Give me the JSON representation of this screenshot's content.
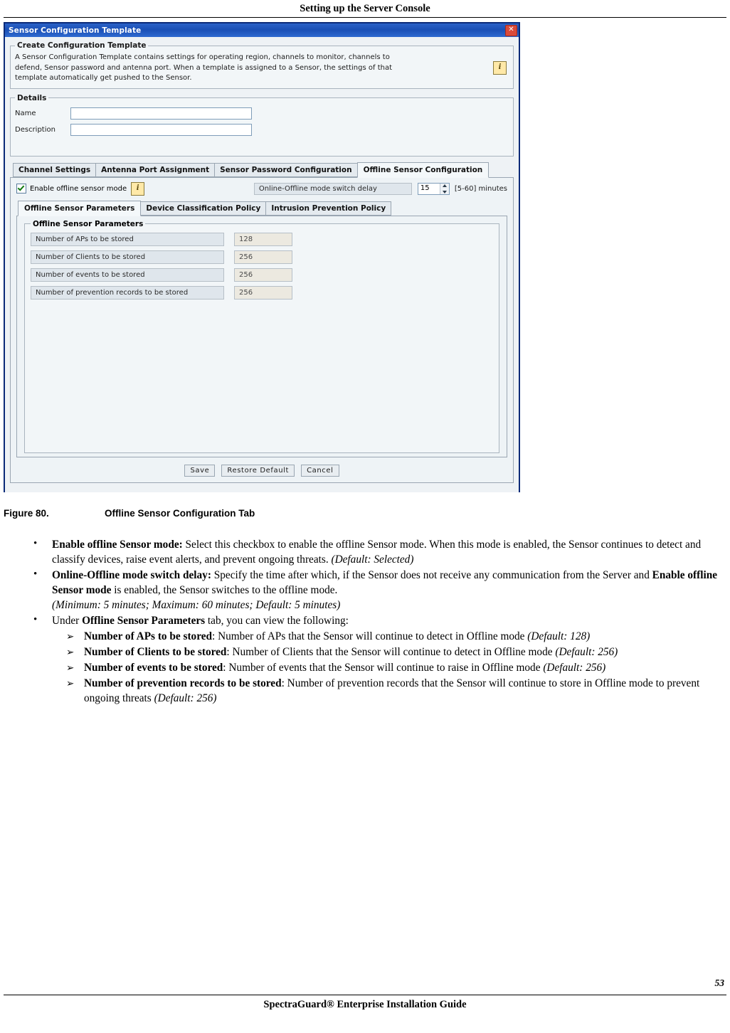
{
  "page": {
    "running_head": "Setting up the Server Console",
    "page_number": "53",
    "footer_title": "SpectraGuard®  Enterprise Installation Guide"
  },
  "dialog": {
    "title": "Sensor Configuration Template",
    "close_icon": "✕",
    "create_group": {
      "legend": "Create Configuration Template",
      "description": "A Sensor Configuration Template contains settings for operating region, channels to monitor, channels to defend, Sensor password and antenna port. When a template is assigned to a Sensor, the settings of that template automatically get pushed to the Sensor.",
      "info_icon": "i"
    },
    "details_group": {
      "legend": "Details",
      "name_label": "Name",
      "name_value": "",
      "description_label": "Description",
      "description_value": ""
    },
    "tabs": [
      {
        "label": "Channel Settings",
        "active": false
      },
      {
        "label": "Antenna Port Assignment",
        "active": false
      },
      {
        "label": "Sensor Password Configuration",
        "active": false
      },
      {
        "label": "Offline Sensor Configuration",
        "active": true
      }
    ],
    "offline": {
      "checkbox_label": "Enable offline sensor mode",
      "checkbox_checked": true,
      "info_icon": "i",
      "delay_label": "Online-Offline mode switch delay",
      "delay_value": "15",
      "range_note": "[5-60] minutes"
    },
    "inner_tabs": [
      {
        "label": "Offline Sensor Parameters",
        "active": true
      },
      {
        "label": "Device Classification Policy",
        "active": false
      },
      {
        "label": "Intrusion Prevention Policy",
        "active": false
      }
    ],
    "parameters_group": {
      "legend": "Offline Sensor Parameters",
      "rows": [
        {
          "label": "Number of APs to be stored",
          "value": "128"
        },
        {
          "label": "Number of Clients to be stored",
          "value": "256"
        },
        {
          "label": "Number of events to be stored",
          "value": "256"
        },
        {
          "label": "Number of prevention records to be stored",
          "value": "256"
        }
      ]
    },
    "buttons": [
      {
        "label": "Save"
      },
      {
        "label": "Restore Default"
      },
      {
        "label": "Cancel"
      }
    ]
  },
  "figure": {
    "number": "Figure  80.",
    "caption": "Offline Sensor Configuration Tab"
  },
  "body": {
    "bullets": [
      {
        "bullet": "•",
        "term": "Enable offline Sensor mode:",
        "text": " Select this checkbox to enable the offline Sensor mode. When this mode is enabled, the Sensor continues to detect and classify devices, raise event alerts, and prevent ongoing threats. ",
        "italic_tail": "(Default: Selected)"
      },
      {
        "bullet": "•",
        "term": "Online-Offline mode switch delay:",
        "text": " Specify the time after which, if the Sensor does not receive any communication from the Server and ",
        "term2": "Enable offline Sensor mode",
        "text2": " is enabled, the Sensor switches to the offline mode.",
        "italic_tail": "(Minimum: 5 minutes; Maximum: 60 minutes; Default: 5 minutes)"
      }
    ],
    "under_line": {
      "bullet": "•",
      "prefix": "Under ",
      "term": "Offline Sensor Parameters",
      "suffix": " tab, you can view the following:"
    },
    "sub_items": [
      {
        "arrow": "➢",
        "term": "Number of APs to be stored",
        "text": ": Number of APs that the Sensor will continue to detect in Offline mode ",
        "italic_tail": "(Default: 128)"
      },
      {
        "arrow": "➢",
        "term": "Number of Clients to be stored",
        "text": ": Number of Clients that the Sensor will continue to detect in Offline mode ",
        "italic_tail": "(Default: 256)"
      },
      {
        "arrow": "➢",
        "term": "Number of events to be stored",
        "text": ": Number of events that the Sensor will continue to raise in Offline mode ",
        "italic_tail": "(Default: 256)"
      },
      {
        "arrow": "➢",
        "term": "Number of prevention records to be stored",
        "text": ": Number of prevention records that the Sensor will continue to store in Offline mode to prevent ongoing threats ",
        "italic_tail": "(Default: 256)"
      }
    ]
  }
}
